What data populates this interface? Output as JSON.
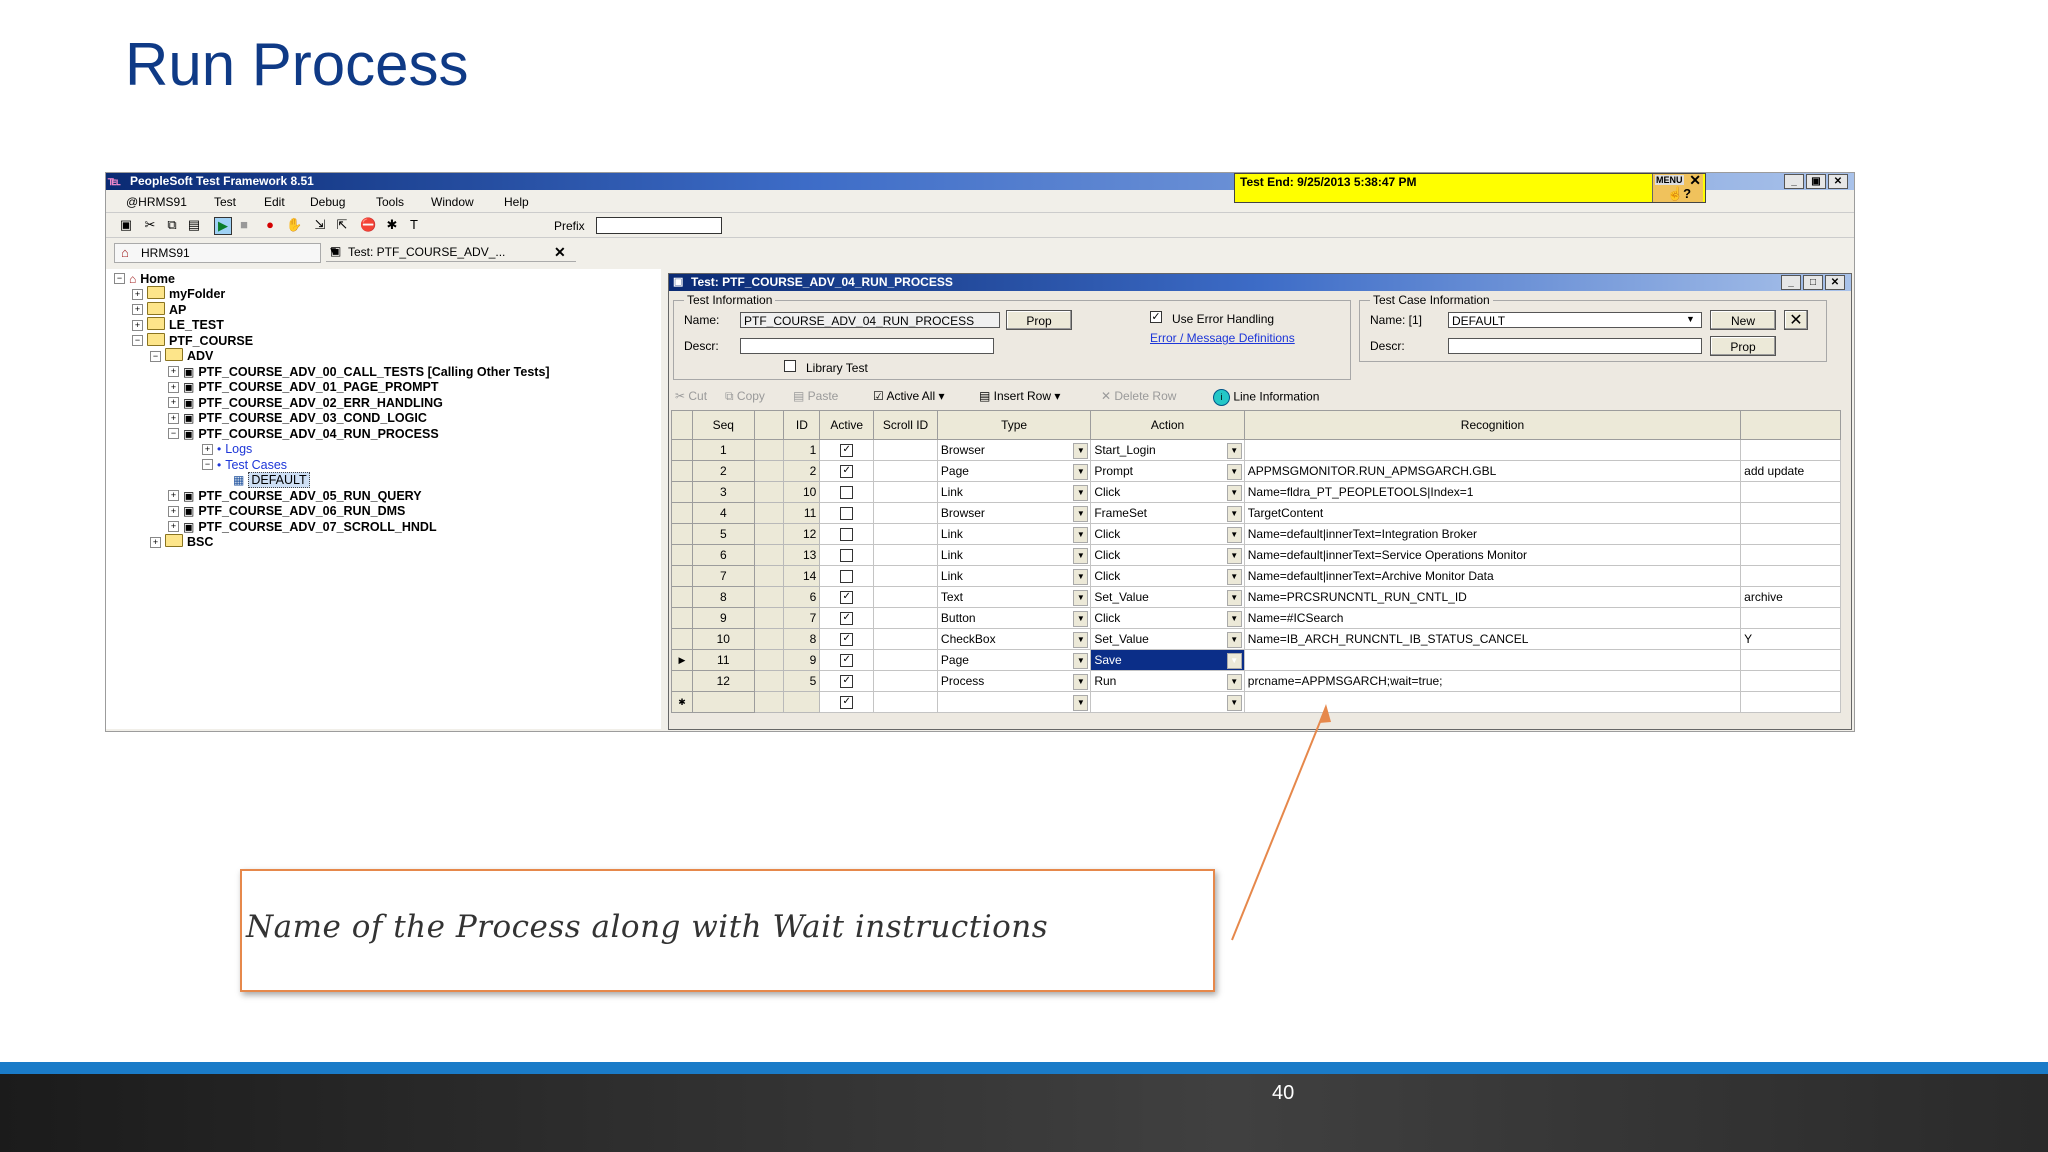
{
  "slide": {
    "title": "Run Process",
    "page_number": "40"
  },
  "app": {
    "title": "PeopleSoft Test Framework 8.51",
    "test_end": "Test End:  9/25/2013 5:38:47 PM",
    "menu_box_label": "MENU",
    "window_buttons": [
      "_",
      "▣",
      "✕"
    ],
    "menu": [
      "@HRMS91",
      "Test",
      "Edit",
      "Debug",
      "Tools",
      "Window",
      "Help"
    ],
    "toolbar_prefix_label": "Prefix",
    "toolbar_prefix_value": "",
    "env_tab": "HRMS91",
    "test_tab": "Test: PTF_COURSE_ADV_..."
  },
  "tree": [
    {
      "label": "Home",
      "level": 0,
      "exp": "−",
      "icon": "home"
    },
    {
      "label": "myFolder",
      "level": 1,
      "exp": "+",
      "icon": "folder-my"
    },
    {
      "label": "AP",
      "level": 1,
      "exp": "+",
      "icon": "folder"
    },
    {
      "label": "LE_TEST",
      "level": 1,
      "exp": "+",
      "icon": "folder"
    },
    {
      "label": "PTF_COURSE",
      "level": 1,
      "exp": "−",
      "icon": "folder"
    },
    {
      "label": "ADV",
      "level": 2,
      "exp": "−",
      "icon": "folder"
    },
    {
      "label": "PTF_COURSE_ADV_00_CALL_TESTS [Calling Other Tests]",
      "level": 3,
      "exp": "+",
      "icon": "test-multi"
    },
    {
      "label": "PTF_COURSE_ADV_01_PAGE_PROMPT",
      "level": 3,
      "exp": "+",
      "icon": "test"
    },
    {
      "label": "PTF_COURSE_ADV_02_ERR_HANDLING",
      "level": 3,
      "exp": "+",
      "icon": "test"
    },
    {
      "label": "PTF_COURSE_ADV_03_COND_LOGIC",
      "level": 3,
      "exp": "+",
      "icon": "test"
    },
    {
      "label": "PTF_COURSE_ADV_04_RUN_PROCESS",
      "level": 3,
      "exp": "−",
      "icon": "test"
    },
    {
      "label": "Logs",
      "level": 4,
      "exp": "+",
      "icon": "dot"
    },
    {
      "label": "Test Cases",
      "level": 4,
      "exp": "−",
      "icon": "dot"
    },
    {
      "label": "DEFAULT",
      "level": 5,
      "exp": "",
      "icon": "case"
    },
    {
      "label": "PTF_COURSE_ADV_05_RUN_QUERY",
      "level": 3,
      "exp": "+",
      "icon": "test"
    },
    {
      "label": "PTF_COURSE_ADV_06_RUN_DMS",
      "level": 3,
      "exp": "+",
      "icon": "test"
    },
    {
      "label": "PTF_COURSE_ADV_07_SCROLL_HNDL",
      "level": 3,
      "exp": "+",
      "icon": "test"
    },
    {
      "label": "BSC",
      "level": 2,
      "exp": "+",
      "icon": "folder"
    }
  ],
  "test_window": {
    "title": "Test: PTF_COURSE_ADV_04_RUN_PROCESS",
    "test_info_label": "Test Information",
    "name_label": "Name:",
    "name_value": "PTF_COURSE_ADV_04_RUN_PROCESS",
    "prop_label": "Prop",
    "descr_label": "Descr:",
    "descr_value": "",
    "use_error_handling": "Use Error Handling",
    "error_link": "Error / Message Definitions",
    "library_test": "Library Test",
    "case_info_label": "Test Case Information",
    "case_name_label": "Name:  [1]",
    "case_name_value": "DEFAULT",
    "new_label": "New",
    "case_descr_label": "Descr:",
    "case_prop_label": "Prop"
  },
  "grid_toolbar": {
    "cut": "Cut",
    "copy": "Copy",
    "paste": "Paste",
    "active_all": "Active All",
    "insert_row": "Insert Row",
    "delete_row": "Delete Row",
    "line_info": "Line Information"
  },
  "grid": {
    "headers": {
      "seq": "Seq",
      "id": "ID",
      "active": "Active",
      "scroll_id": "Scroll ID",
      "type": "Type",
      "action": "Action",
      "recognition": "Recognition",
      "parameters": ""
    },
    "rows": [
      {
        "seq": "1",
        "id": "1",
        "active": true,
        "type": "Browser",
        "action": "Start_Login",
        "recognition": "",
        "param": ""
      },
      {
        "seq": "2",
        "id": "2",
        "active": true,
        "type": "Page",
        "action": "Prompt",
        "recognition": "APPMSGMONITOR.RUN_APMSGARCH.GBL",
        "param": "add update"
      },
      {
        "seq": "3",
        "id": "10",
        "active": false,
        "type": "Link",
        "action": "Click",
        "recognition": "Name=fldra_PT_PEOPLETOOLS|Index=1",
        "param": ""
      },
      {
        "seq": "4",
        "id": "11",
        "active": false,
        "type": "Browser",
        "action": "FrameSet",
        "recognition": "TargetContent",
        "param": ""
      },
      {
        "seq": "5",
        "id": "12",
        "active": false,
        "type": "Link",
        "action": "Click",
        "recognition": "Name=default|innerText=Integration Broker",
        "param": ""
      },
      {
        "seq": "6",
        "id": "13",
        "active": false,
        "type": "Link",
        "action": "Click",
        "recognition": "Name=default|innerText=Service Operations Monitor",
        "param": ""
      },
      {
        "seq": "7",
        "id": "14",
        "active": false,
        "type": "Link",
        "action": "Click",
        "recognition": "Name=default|innerText=Archive Monitor Data",
        "param": ""
      },
      {
        "seq": "8",
        "id": "6",
        "active": true,
        "type": "Text",
        "action": "Set_Value",
        "recognition": "Name=PRCSRUNCNTL_RUN_CNTL_ID",
        "param": "archive"
      },
      {
        "seq": "9",
        "id": "7",
        "active": true,
        "type": "Button",
        "action": "Click",
        "recognition": "Name=#ICSearch",
        "param": ""
      },
      {
        "seq": "10",
        "id": "8",
        "active": true,
        "type": "CheckBox",
        "action": "Set_Value",
        "recognition": "Name=IB_ARCH_RUNCNTL_IB_STATUS_CANCEL",
        "param": "Y"
      },
      {
        "seq": "11",
        "id": "9",
        "active": true,
        "type": "Page",
        "action": "Save",
        "recognition": "",
        "param": "",
        "current": true
      },
      {
        "seq": "12",
        "id": "5",
        "active": true,
        "type": "Process",
        "action": "Run",
        "recognition": "prcname=APPMSGARCH;wait=true;",
        "param": ""
      },
      {
        "seq": "",
        "id": "",
        "active": true,
        "type": "",
        "action": "",
        "recognition": "",
        "param": "",
        "new_row": true
      }
    ],
    "new_row_marker": "✱",
    "current_row_marker": "▶"
  },
  "callout": {
    "text": "Name of the Process along with Wait instructions",
    "color": "#e6884b"
  }
}
